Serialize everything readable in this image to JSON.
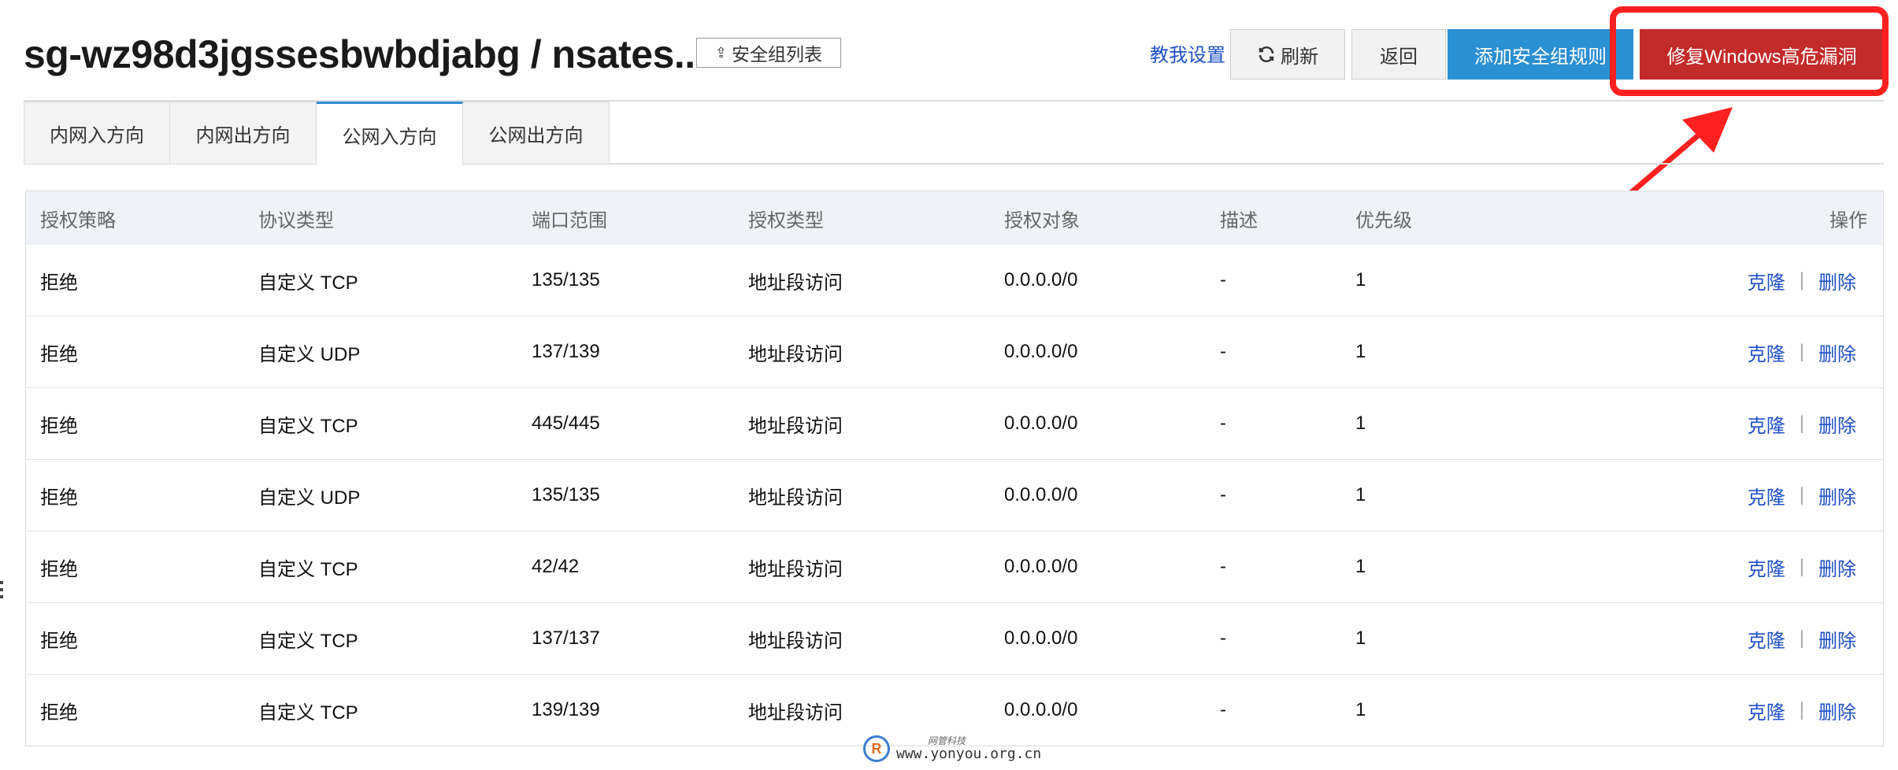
{
  "header": {
    "title": "sg-wz98d3jgssesbwbdjabg / nsates...",
    "sg_list_label": "安全组列表",
    "tutorial_label": "教我设置",
    "refresh_label": "刷新",
    "back_label": "返回",
    "add_rule_label": "添加安全组规则",
    "fix_windows_label": "修复Windows高危漏洞"
  },
  "tabs": [
    {
      "label": "内网入方向",
      "active": false
    },
    {
      "label": "内网出方向",
      "active": false
    },
    {
      "label": "公网入方向",
      "active": true
    },
    {
      "label": "公网出方向",
      "active": false
    }
  ],
  "table": {
    "columns": [
      "授权策略",
      "协议类型",
      "端口范围",
      "授权类型",
      "授权对象",
      "描述",
      "优先级",
      "操作"
    ],
    "rows": [
      {
        "policy": "拒绝",
        "protocol": "自定义 TCP",
        "port": "135/135",
        "auth_type": "地址段访问",
        "target": "0.0.0.0/0",
        "desc": "-",
        "priority": "1"
      },
      {
        "policy": "拒绝",
        "protocol": "自定义 UDP",
        "port": "137/139",
        "auth_type": "地址段访问",
        "target": "0.0.0.0/0",
        "desc": "-",
        "priority": "1"
      },
      {
        "policy": "拒绝",
        "protocol": "自定义 TCP",
        "port": "445/445",
        "auth_type": "地址段访问",
        "target": "0.0.0.0/0",
        "desc": "-",
        "priority": "1"
      },
      {
        "policy": "拒绝",
        "protocol": "自定义 UDP",
        "port": "135/135",
        "auth_type": "地址段访问",
        "target": "0.0.0.0/0",
        "desc": "-",
        "priority": "1"
      },
      {
        "policy": "拒绝",
        "protocol": "自定义 TCP",
        "port": "42/42",
        "auth_type": "地址段访问",
        "target": "0.0.0.0/0",
        "desc": "-",
        "priority": "1"
      },
      {
        "policy": "拒绝",
        "protocol": "自定义 TCP",
        "port": "137/137",
        "auth_type": "地址段访问",
        "target": "0.0.0.0/0",
        "desc": "-",
        "priority": "1"
      },
      {
        "policy": "拒绝",
        "protocol": "自定义 TCP",
        "port": "139/139",
        "auth_type": "地址段访问",
        "target": "0.0.0.0/0",
        "desc": "-",
        "priority": "1"
      }
    ],
    "clone_label": "克隆",
    "delete_label": "删除",
    "separator": "|"
  },
  "icons": {
    "sg_list": "upload-arrow-icon",
    "refresh": "refresh-icon",
    "annotation": "red-arrow-icon"
  },
  "colors": {
    "primary_blue": "#2b8fd4",
    "danger_red": "#c32a2a",
    "annotation_red": "#ff2020",
    "link_blue": "#1f50c7"
  },
  "watermark": {
    "cn": "网管科技",
    "url": "www.yonyou.org.cn"
  }
}
